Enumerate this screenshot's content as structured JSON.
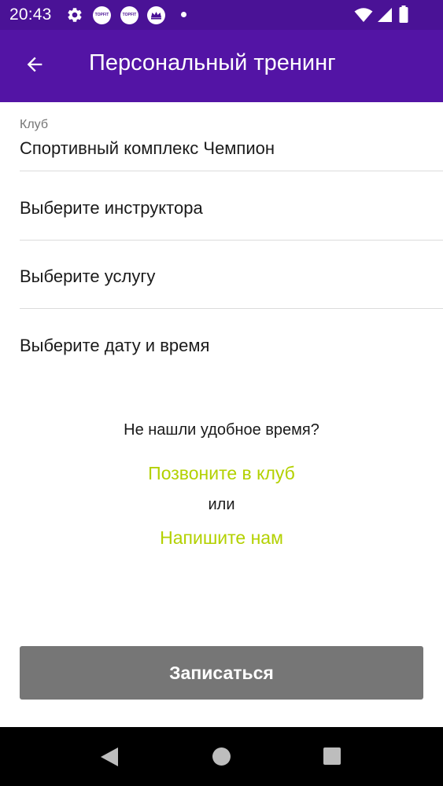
{
  "status_bar": {
    "time": "20:43",
    "notifications": [
      "TOPFIT",
      "TOPFIT"
    ],
    "icons": [
      "settings-icon",
      "topfit-notification-icon",
      "topfit-notification-icon",
      "crown-notification-icon",
      "wifi-icon",
      "signal-icon",
      "battery-icon"
    ]
  },
  "app_bar": {
    "title": "Персональный тренинг",
    "back_icon": "arrow-back-icon"
  },
  "form": {
    "club_label": "Клуб",
    "club_value": "Спортивный комплекс Чемпион",
    "instructor_label": "Выберите инструктора",
    "service_label": "Выберите услугу",
    "datetime_label": "Выберите дату и время"
  },
  "help": {
    "question": "Не нашли удобное время?",
    "call_link": "Позвоните в клуб",
    "or_text": "или",
    "write_link": "Напишите нам"
  },
  "submit": {
    "label": "Записаться"
  },
  "colors": {
    "status_bar": "#4a1296",
    "app_bar": "#5314a5",
    "link": "#b3d100",
    "button": "#767676"
  }
}
